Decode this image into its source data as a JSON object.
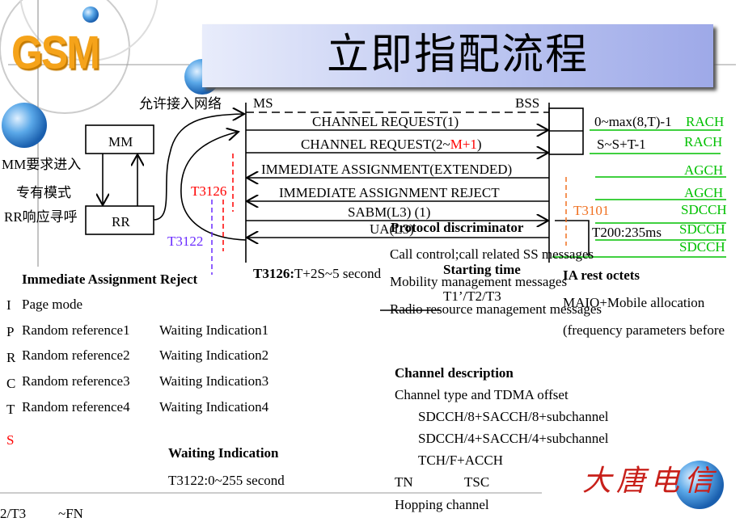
{
  "logo": {
    "text": "GSM",
    "bottom_logo_text": "大唐电信"
  },
  "title": "立即指配流程",
  "diagram": {
    "ms_label": "MS",
    "bss_label": "BSS",
    "allow_access": "允许接入网络",
    "mm_box": "MM",
    "rr_box": "RR",
    "mm_request": "MM要求进入",
    "dedicated_mode": "专有模式",
    "rr_paging": "RR响应寻呼",
    "t3126": "T3126",
    "t3122": "T3122",
    "t3101": "T3101",
    "messages": [
      {
        "pre": "CHANNEL REQUEST(1)",
        "highlight": "",
        "post": "",
        "direction": "ms-to-bss"
      },
      {
        "pre": "CHANNEL REQUEST(2~",
        "highlight": "M+1",
        "post": ")",
        "direction": "ms-to-bss"
      },
      {
        "pre": "IMMEDIATE ASSIGNMENT(EXTENDED)",
        "direction": "bss-to-ms"
      },
      {
        "pre": "IMMEDIATE ASSIGNMENT REJECT",
        "direction": "bss-to-ms"
      },
      {
        "pre": "SABM(L3) (1)",
        "direction": "ms-to-bss"
      },
      {
        "pre": "UA(L3)",
        "direction": "bss-to-ms"
      }
    ],
    "rach_range1": "0~max(8,T)-1",
    "rach_range2": "S~S+T-1",
    "t200": "T200:235ms",
    "channels": [
      "RACH",
      "RACH",
      "AGCH",
      "AGCH",
      "SDCCH",
      "SDCCH",
      "SDCCH"
    ],
    "t3126_note_bold": "T3126:",
    "t3126_note": "T+2S~5 second",
    "colors": {
      "highlight": "#ff0000",
      "channel": "#00c000",
      "t3126": "#ff0000",
      "t3122": "#6a2bff",
      "t3101": "#f07020"
    }
  },
  "protocol": {
    "heading": "Protocol discriminator",
    "items": [
      "Call control;call related SS messages",
      "Mobility management messages",
      "Radio resource management messages"
    ]
  },
  "starting_time": {
    "heading": "Starting time",
    "value": "T1’/T2/T3"
  },
  "ia_rest": {
    "heading": "IA rest octets",
    "items": [
      "MAIO+Mobile allocation",
      "(frequency parameters before"
    ]
  },
  "reject": {
    "heading": "Immediate Assignment Reject",
    "letters": [
      "I",
      "P",
      "R",
      "C",
      "T",
      "S"
    ],
    "page_mode": "Page mode",
    "random_refs": [
      "Random reference1",
      "Random reference2",
      "Random reference3",
      "Random reference4"
    ],
    "waiting": [
      "Waiting Indication1",
      "Waiting Indication2",
      "Waiting Indication3",
      "Waiting Indication4"
    ]
  },
  "waiting_indication": {
    "heading": "Waiting Indication",
    "value": "T3122:0~255 second"
  },
  "clipped_bottom": {
    "left": "2/T3",
    "right": "~FN"
  },
  "channel_description": {
    "heading": "Channel description",
    "subheading": "Channel type and TDMA offset",
    "types": [
      "SDCCH/8+SACCH/8+subchannel",
      "SDCCH/4+SACCH/4+subchannel",
      "TCH/F+ACCH"
    ],
    "tn": "TN",
    "tsc": "TSC",
    "hopping": "Hopping channel"
  }
}
